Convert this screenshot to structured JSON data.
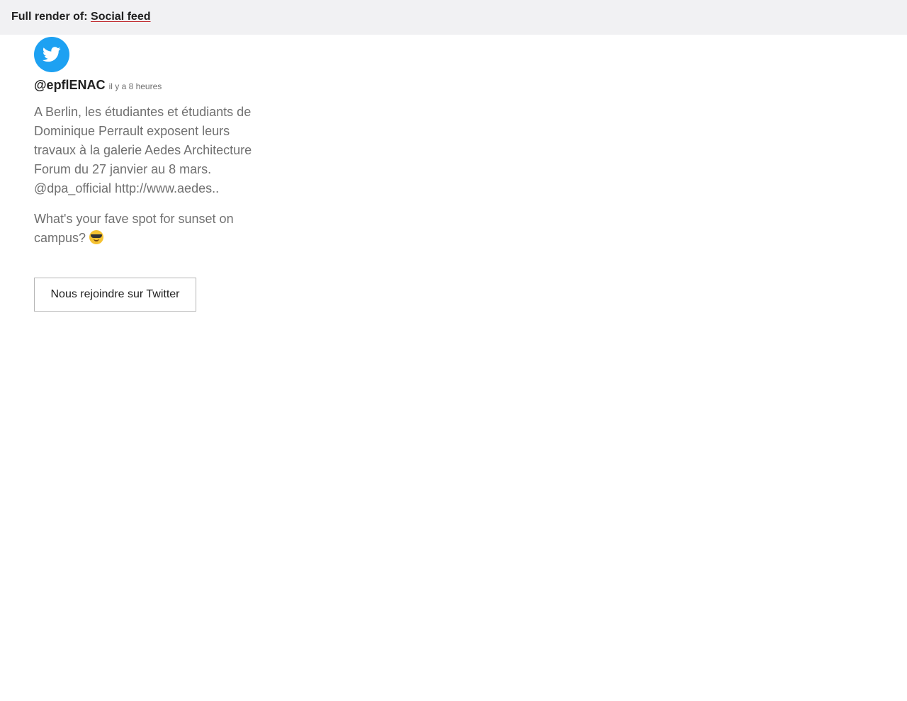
{
  "header": {
    "prefix": "Full render of:",
    "link_label": "Social feed"
  },
  "feed": {
    "network_icon": "twitter-bird-icon",
    "network_color": "#1da1f2",
    "handle": "@epflENAC",
    "time": "il y a 8 heures",
    "tweets": [
      {
        "text": "A Berlin, les étudiantes et étudiants de Dominique Perrault exposent leurs travaux à la galerie Aedes Architecture Forum du 27 janvier au 8 mars. @dpa_official http://www.aedes.."
      },
      {
        "text": "What's your fave spot for sunset on campus?",
        "emoji": "smiling-face-with-sunglasses-icon"
      }
    ],
    "join_button_label": "Nous rejoindre sur Twitter"
  }
}
